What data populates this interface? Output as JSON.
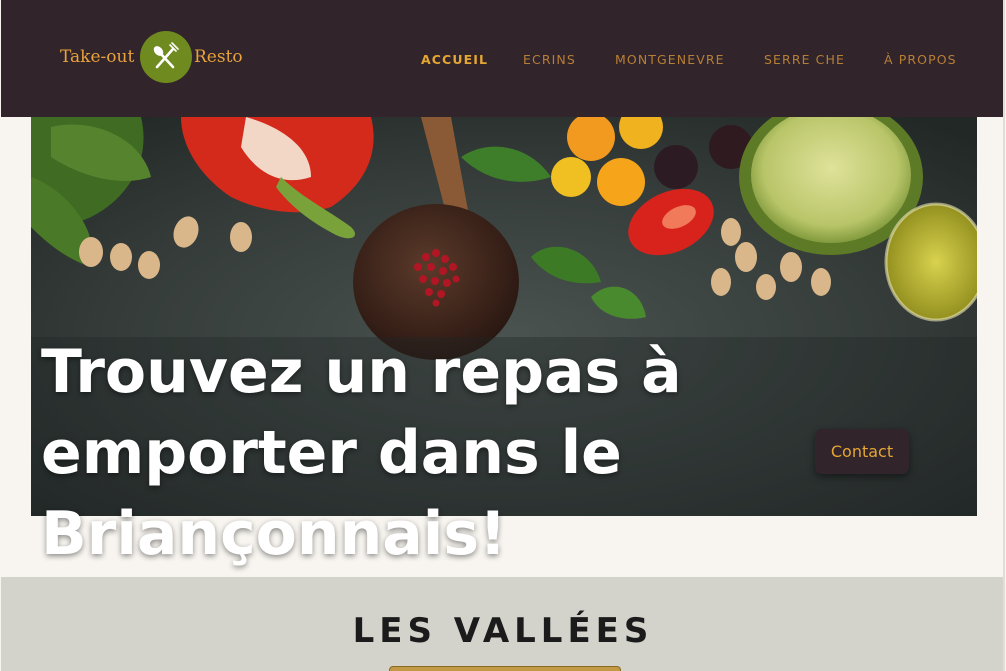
{
  "header": {
    "logo": {
      "text_left": "Take-out",
      "text_right": "Resto",
      "badge_icon": "fork-knife-icon",
      "badge_color": "#6f8a1e",
      "text_color": "#e8a33c"
    },
    "nav": [
      {
        "label": "ACCUEIL",
        "active": true
      },
      {
        "label": "ECRINS",
        "active": false
      },
      {
        "label": "MONTGENEVRE",
        "active": false
      },
      {
        "label": "SERRE CHE",
        "active": false
      },
      {
        "label": "À PROPOS",
        "active": false
      }
    ],
    "background": "#31242a",
    "nav_color": "#b77f36",
    "nav_active_color": "#e5a733"
  },
  "hero": {
    "heading": "Trouvez un repas à emporter dans le Briançonnais!",
    "contact_label": "Contact",
    "image": "vegetables-on-dark-stone-photo"
  },
  "section": {
    "title": "LES VALLÉES",
    "background": "#d3d3cc",
    "accent": "#c29a45"
  }
}
